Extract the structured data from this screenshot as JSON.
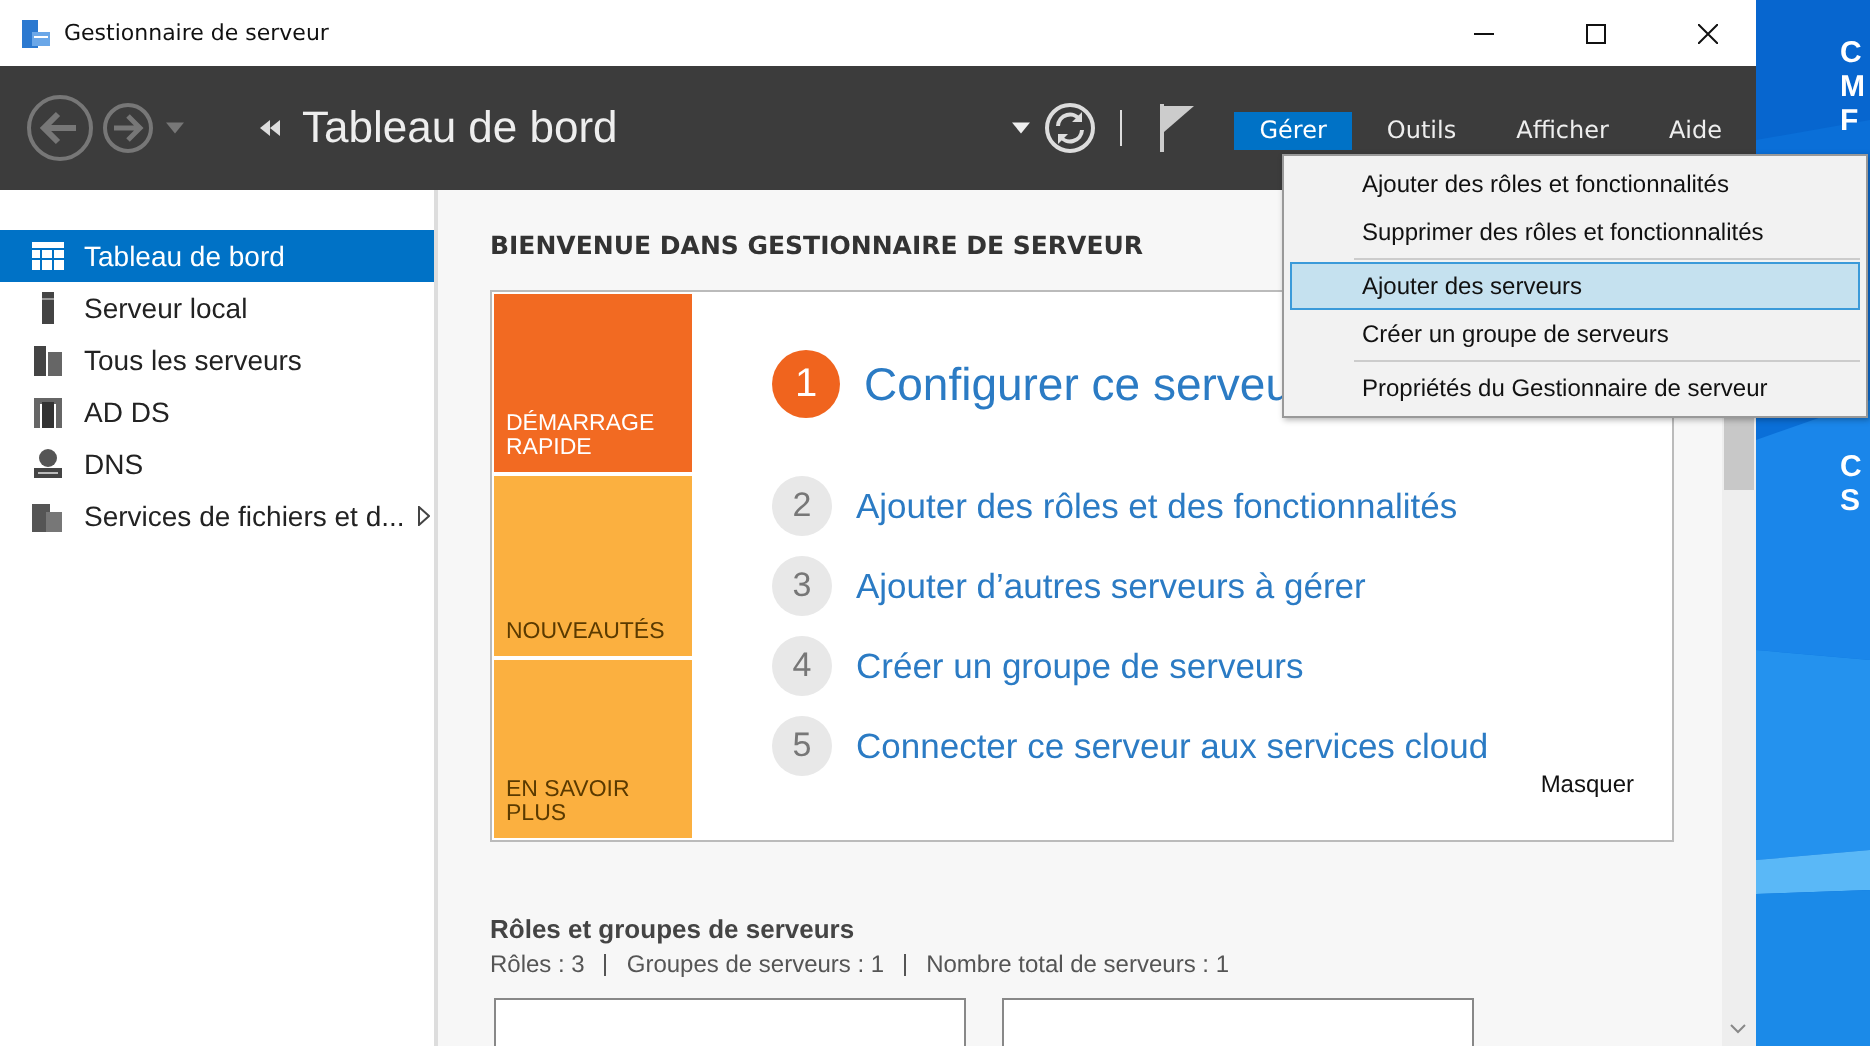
{
  "window": {
    "title": "Gestionnaire de serveur"
  },
  "header": {
    "title": "Tableau de bord",
    "menus": [
      {
        "label": "Gérer",
        "selected": true
      },
      {
        "label": "Outils",
        "selected": false
      },
      {
        "label": "Afficher",
        "selected": false
      },
      {
        "label": "Aide",
        "selected": false
      }
    ]
  },
  "sidebar": {
    "items": [
      {
        "label": "Tableau de bord",
        "kind": "dashboard",
        "selected": true,
        "has_submenu": false
      },
      {
        "label": "Serveur local",
        "kind": "server",
        "selected": false,
        "has_submenu": false
      },
      {
        "label": "Tous les serveurs",
        "kind": "servers",
        "selected": false,
        "has_submenu": false
      },
      {
        "label": "AD DS",
        "kind": "adds",
        "selected": false,
        "has_submenu": false
      },
      {
        "label": "DNS",
        "kind": "dns",
        "selected": false,
        "has_submenu": false
      },
      {
        "label": "Services de fichiers et d...",
        "kind": "files",
        "selected": false,
        "has_submenu": true
      }
    ]
  },
  "welcome": {
    "heading": "BIENVENUE DANS GESTIONNAIRE DE SERVEUR",
    "tiles": [
      {
        "label": "DÉMARRAGE RAPIDE",
        "color": "#f26a22"
      },
      {
        "label": "NOUVEAUTÉS",
        "color": "#fbb040"
      },
      {
        "label": "EN SAVOIR PLUS",
        "color": "#fbb040"
      }
    ],
    "steps": [
      {
        "number": "1",
        "label": "Configurer ce serveu",
        "primary": true
      },
      {
        "number": "2",
        "label": "Ajouter des rôles et des fonctionnalités",
        "primary": false
      },
      {
        "number": "3",
        "label": "Ajouter d’autres serveurs à gérer",
        "primary": false
      },
      {
        "number": "4",
        "label": "Créer un groupe de serveurs",
        "primary": false
      },
      {
        "number": "5",
        "label": "Connecter ce serveur aux services cloud",
        "primary": false
      }
    ],
    "hide_link": "Masquer"
  },
  "roles": {
    "heading": "Rôles et groupes de serveurs",
    "stats": [
      "Rôles : 3",
      "Groupes de serveurs : 1",
      "Nombre total de serveurs : 1"
    ]
  },
  "dropdown": {
    "items": [
      {
        "label": "Ajouter des rôles et fonctionnalités",
        "selected": false,
        "separator_after": false
      },
      {
        "label": "Supprimer des rôles et fonctionnalités",
        "selected": false,
        "separator_after": true
      },
      {
        "label": "Ajouter des serveurs",
        "selected": true,
        "separator_after": false
      },
      {
        "label": "Créer un groupe de serveurs",
        "selected": false,
        "separator_after": true
      },
      {
        "label": "Propriétés du Gestionnaire de serveur",
        "selected": false,
        "separator_after": false
      }
    ]
  },
  "desktop": {
    "text_groups": [
      [
        "C",
        "M",
        "F"
      ],
      [
        "C",
        "S"
      ]
    ]
  }
}
